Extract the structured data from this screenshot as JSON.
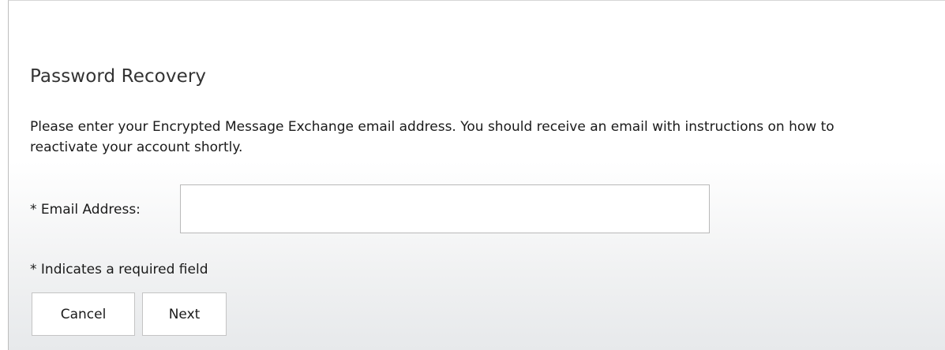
{
  "form": {
    "title": "Password Recovery",
    "instructions": "Please enter your Encrypted Message Exchange email address. You should receive an email with instructions on how to reactivate your account shortly.",
    "email_label": "* Email Address:",
    "email_value": "",
    "email_placeholder": "",
    "required_note": "* Indicates a required field",
    "cancel_label": "Cancel",
    "next_label": "Next"
  }
}
